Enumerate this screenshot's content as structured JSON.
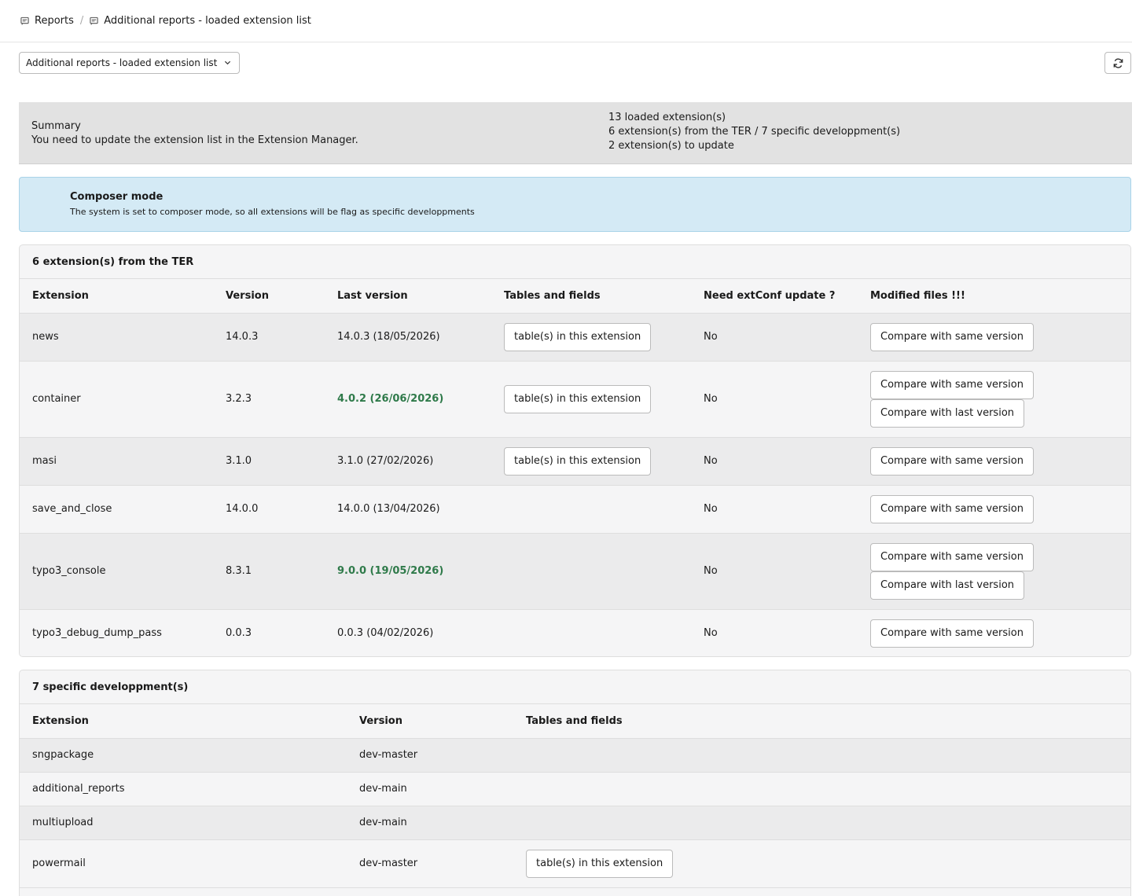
{
  "breadcrumb": {
    "items": [
      "Reports",
      "Additional reports - loaded extension list"
    ],
    "separator": "/"
  },
  "module_select": {
    "value": "Additional reports - loaded extension list"
  },
  "summary": {
    "title": "Summary",
    "message": "You need to update the extension list in the Extension Manager.",
    "loaded": "13 loaded extension(s)",
    "split": "6 extension(s) from the TER / 7 specific developpment(s)",
    "to_update": "2 extension(s) to update"
  },
  "callout": {
    "title": "Composer mode",
    "message": "The system is set to composer mode, so all extensions will be flag as specific developpments"
  },
  "ter_panel": {
    "title": "6 extension(s) from the TER",
    "headers": [
      "Extension",
      "Version",
      "Last version",
      "Tables and fields",
      "Need extConf update ?",
      "Modified files !!!"
    ],
    "rows": [
      {
        "extension": "news",
        "version": "14.0.3",
        "last_version": "14.0.3 (18/05/2026)",
        "has_tables": true,
        "extconf": "No",
        "compare_last": false
      },
      {
        "extension": "container",
        "version": "3.2.3",
        "last_version": "4.0.2 (26/06/2026)",
        "has_tables": true,
        "extconf": "No",
        "compare_last": true
      },
      {
        "extension": "masi",
        "version": "3.1.0",
        "last_version": "3.1.0 (27/02/2026)",
        "has_tables": true,
        "extconf": "No",
        "compare_last": false
      },
      {
        "extension": "save_and_close",
        "version": "14.0.0",
        "last_version": "14.0.0 (13/04/2026)",
        "has_tables": false,
        "extconf": "No",
        "compare_last": false
      },
      {
        "extension": "typo3_console",
        "version": "8.3.1",
        "last_version": "9.0.0 (19/05/2026)",
        "has_tables": false,
        "extconf": "No",
        "compare_last": true
      },
      {
        "extension": "typo3_debug_dump_pass",
        "version": "0.0.3",
        "last_version": "0.0.3 (04/02/2026)",
        "has_tables": false,
        "extconf": "No",
        "compare_last": false
      }
    ],
    "tables_label": "table(s) in this extension",
    "compare_same_label": "Compare with same version",
    "compare_last_label": "Compare with last version"
  },
  "dev_panel": {
    "title": "7 specific developpment(s)",
    "headers": [
      "Extension",
      "Version",
      "Tables and fields"
    ],
    "rows": [
      {
        "extension": "sngpackage",
        "version": "dev-master",
        "has_tables": false
      },
      {
        "extension": "additional_reports",
        "version": "dev-main",
        "has_tables": false
      },
      {
        "extension": "multiupload",
        "version": "dev-main",
        "has_tables": false
      },
      {
        "extension": "powermail",
        "version": "dev-master",
        "has_tables": true
      }
    ],
    "tables_label": "table(s) in this extension"
  },
  "colors": {
    "update_available": "#2f7a4a",
    "callout_bg": "#d4eaf5",
    "summary_bg": "#e2e2e2"
  }
}
